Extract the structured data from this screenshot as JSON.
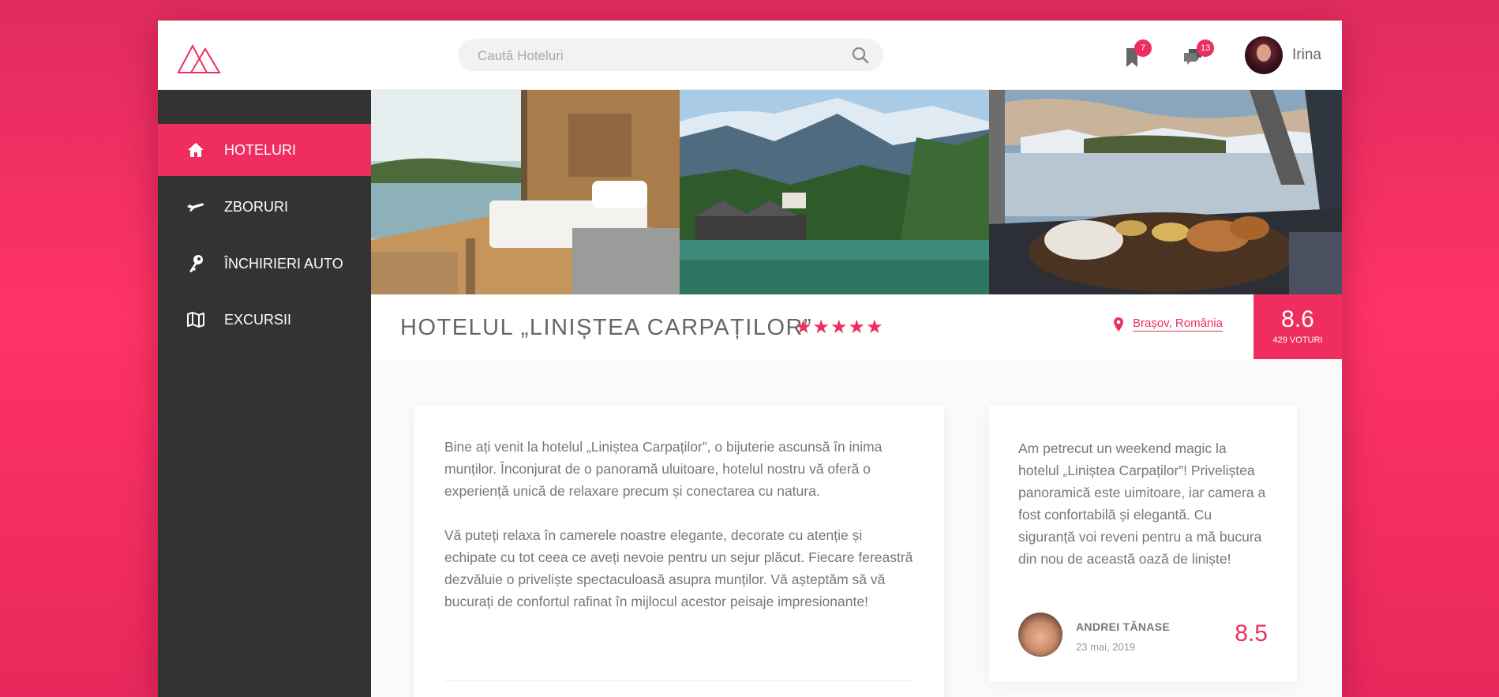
{
  "header": {
    "search_placeholder": "Caută Hoteluri",
    "bookmarks_count": "7",
    "messages_count": "13",
    "user_name": "Irina"
  },
  "sidebar": {
    "items": [
      {
        "label": "HOTELURI",
        "icon": "home-icon",
        "active": true
      },
      {
        "label": "ZBORURI",
        "icon": "plane-icon",
        "active": false
      },
      {
        "label": "ÎNCHIRIERI AUTO",
        "icon": "key-icon",
        "active": false
      },
      {
        "label": "EXCURSII",
        "icon": "map-icon",
        "active": false
      }
    ]
  },
  "hotel": {
    "title": "HOTELUL „LINIȘTEA CARPAȚILOR”",
    "stars": "★★★★★",
    "location": "Brașov, România",
    "score": "8.6",
    "votes": "429 VOTURI"
  },
  "description": {
    "paragraphs": [
      "Bine ați venit la hotelul „Liniștea Carpaților”, o bijuterie ascunsă în inima munților. Înconjurat de o panoramă uluitoare, hotelul nostru vă oferă o experiență unică de relaxare precum și conectarea cu natura.",
      "Vă puteți relaxa în camerele noastre elegante, decorate cu atenție și echipate cu tot ceea ce aveți nevoie pentru un sejur plăcut. Fiecare fereastră dezvăluie o priveliște spectaculoasă asupra munților. Vă așteptăm să vă bucurați de confortul rafinat în mijlocul acestor peisaje impresionante!"
    ]
  },
  "review": {
    "quote_mark": "“",
    "text": "Am petrecut un weekend magic la hotelul „Liniștea Carpaților”! Priveliștea panoramică este uimitoare, iar camera a fost confortabilă și elegantă. Cu siguranță voi reveni pentru a mă bucura din nou de această oază de liniște!",
    "author": "ANDREI TĂNASE",
    "date": "23 mai, 2019",
    "score": "8.5"
  },
  "colors": {
    "accent": "#ef2e5f",
    "sidebar": "#333333",
    "background_gradient": "#ff3366"
  }
}
